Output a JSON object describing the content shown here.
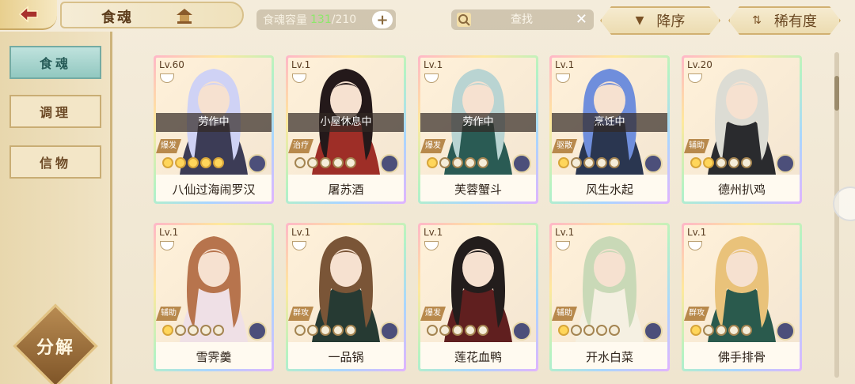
{
  "header": {
    "tab_label": "食魂",
    "capacity_label": "食魂容量",
    "capacity_current": "131",
    "capacity_max": "/210",
    "capacity_plus": "+",
    "search_placeholder": "查找",
    "sort_desc_label": "降序",
    "sort_rarity_label": "稀有度"
  },
  "sidebar": {
    "tabs": [
      {
        "label": "食魂"
      },
      {
        "label": "调理"
      },
      {
        "label": "信物"
      }
    ],
    "decompose_label": "分解"
  },
  "cards": [
    {
      "level": "Lv.60",
      "status": "劳作中",
      "role": "爆发",
      "stars": 5,
      "name": "八仙过海闹罗汉",
      "hair": "#cfd2f5",
      "cloth": "#3c3c56"
    },
    {
      "level": "Lv.1",
      "status": "小屋休息中",
      "role": "治疗",
      "stars": 0,
      "name": "屠苏酒",
      "hair": "#24191a",
      "cloth": "#9e2e27"
    },
    {
      "level": "Lv.1",
      "status": "劳作中",
      "role": "爆发",
      "stars": 1,
      "name": "芙蓉蟹斗",
      "hair": "#b9d4d2",
      "cloth": "#2a5b54"
    },
    {
      "level": "Lv.1",
      "status": "烹饪中",
      "role": "驱散",
      "stars": 1,
      "name": "风生水起",
      "hair": "#6f8edc",
      "cloth": "#2a3650"
    },
    {
      "level": "Lv.20",
      "status": "",
      "role": "辅助",
      "stars": 2,
      "name": "德州扒鸡",
      "hair": "#dcdcd4",
      "cloth": "#2a2b2e"
    },
    {
      "level": "Lv.1",
      "status": "",
      "role": "辅助",
      "stars": 1,
      "name": "雪霁羹",
      "hair": "#b7744d",
      "cloth": "#efe0e6"
    },
    {
      "level": "Lv.1",
      "status": "",
      "role": "群攻",
      "stars": 0,
      "name": "一品锅",
      "hair": "#7a5537",
      "cloth": "#263a33"
    },
    {
      "level": "Lv.1",
      "status": "",
      "role": "爆发",
      "stars": 0,
      "name": "莲花血鸭",
      "hair": "#231d1c",
      "cloth": "#601f1f"
    },
    {
      "level": "Lv.1",
      "status": "",
      "role": "辅助",
      "stars": 1,
      "name": "开水白菜",
      "hair": "#c9d9b7",
      "cloth": "#f5f0e2"
    },
    {
      "level": "Lv.1",
      "status": "",
      "role": "群攻",
      "stars": 1,
      "name": "佛手排骨",
      "hair": "#e9c27a",
      "cloth": "#2a5a4d"
    }
  ]
}
